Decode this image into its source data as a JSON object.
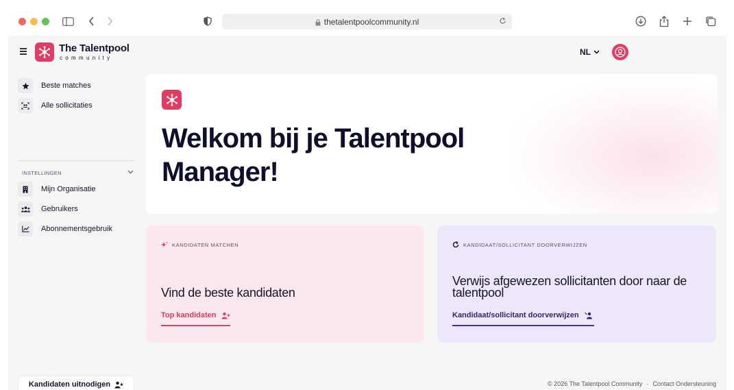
{
  "browser": {
    "url": "thetalentpoolcommunity.nl"
  },
  "brand": {
    "title": "The Talentpool",
    "subtitle": "community",
    "accent": "#e13c64"
  },
  "header": {
    "language": "NL"
  },
  "sidebar": {
    "items": [
      {
        "label": "Beste matches",
        "icon": "star-icon"
      },
      {
        "label": "Alle sollicitaties",
        "icon": "people-scan-icon"
      }
    ],
    "section_label": "INSTELLINGEN",
    "settings_items": [
      {
        "label": "Mijn Organisatie",
        "icon": "building-icon"
      },
      {
        "label": "Gebruikers",
        "icon": "users-icon"
      },
      {
        "label": "Abonnementsgebruik",
        "icon": "chart-line-icon"
      }
    ],
    "invite_label": "Kandidaten uitnodigen"
  },
  "hero": {
    "title": "Welkom bij je Talentpool Manager!"
  },
  "cards": [
    {
      "label": "KANDIDATEN MATCHEN",
      "title": "Vind de beste kandidaten",
      "link": "Top kandidaten",
      "color": "#fbe8ee"
    },
    {
      "label": "KANDIDAAT/SOLLICITANT DOORVERWIJZEN",
      "title": "Verwijs afgewezen sollicitanten door naar de talentpool",
      "link": "Kandidaat/sollicitant doorverwijzen",
      "color": "#ede7f9"
    }
  ],
  "footer": {
    "copyright": "© 2026 The Talentpool Community",
    "separator": "·",
    "contact": "Contact Ondersteuning"
  }
}
